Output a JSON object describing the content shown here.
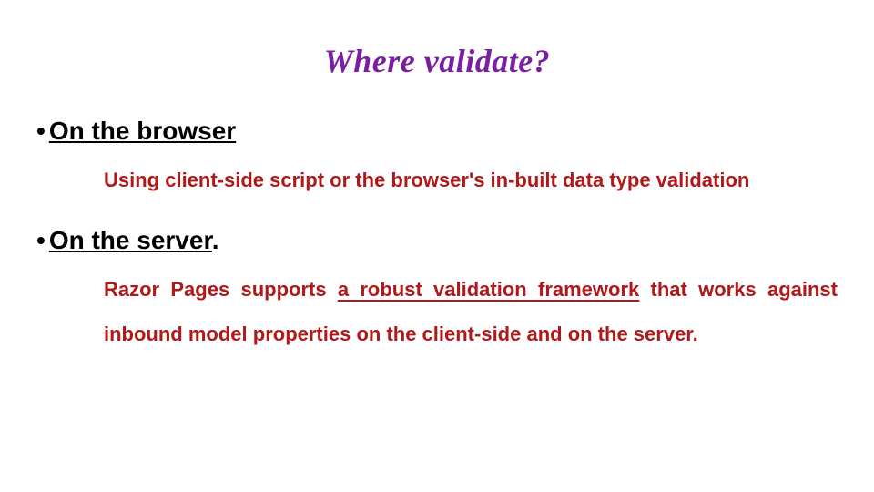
{
  "title": "Where  validate?",
  "sections": [
    {
      "bullet_prefix": "• ",
      "heading": "On the browser",
      "heading_trailing": "",
      "desc_before_link": "Using client-side script or the browser's in-built data type validation",
      "link_text": "",
      "desc_after_link": ""
    },
    {
      "bullet_prefix": "• ",
      "heading": "On the server",
      "heading_trailing": ".",
      "desc_before_link": "Razor Pages supports ",
      "link_text": "a robust validation framework",
      "desc_after_link": " that works against inbound model properties on the client-side and on the server."
    }
  ]
}
